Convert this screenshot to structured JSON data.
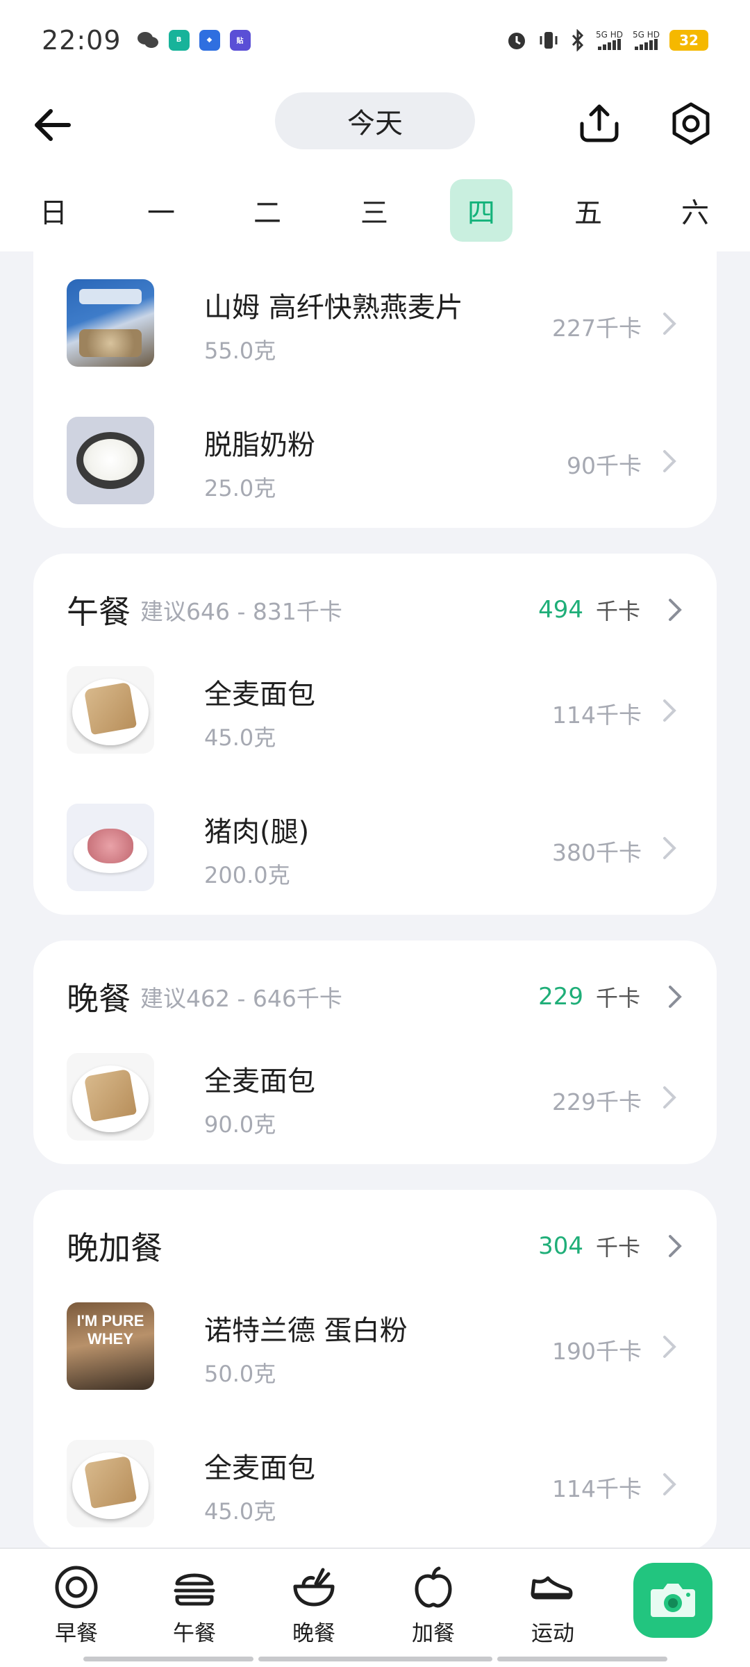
{
  "status_bar": {
    "time": "22:09",
    "battery": "32",
    "network_1": "5G HD",
    "network_2": "5G HD",
    "icons": [
      "wechat-icon",
      "boss-app-icon",
      "app-blue-icon",
      "tie-app-icon",
      "alarm-icon",
      "vibrate-icon",
      "bluetooth-icon"
    ]
  },
  "header": {
    "date_label": "今天"
  },
  "week": {
    "days": [
      "日",
      "一",
      "二",
      "三",
      "四",
      "五",
      "六"
    ],
    "selected_index": 4
  },
  "sections": {
    "breakfast_tail": {
      "items": [
        {
          "name": "山姆 高纤快熟燕麦片",
          "weight": "55.0克",
          "kcal": "227千卡"
        },
        {
          "name": "脱脂奶粉",
          "weight": "25.0克",
          "kcal": "90千卡"
        }
      ]
    },
    "lunch": {
      "title": "午餐",
      "hint": "建议646 - 831千卡",
      "total": "494",
      "unit": "千卡",
      "items": [
        {
          "name": "全麦面包",
          "weight": "45.0克",
          "kcal": "114千卡"
        },
        {
          "name": "猪肉(腿)",
          "weight": "200.0克",
          "kcal": "380千卡"
        }
      ]
    },
    "dinner": {
      "title": "晚餐",
      "hint": "建议462 - 646千卡",
      "total": "229",
      "unit": "千卡",
      "items": [
        {
          "name": "全麦面包",
          "weight": "90.0克",
          "kcal": "229千卡"
        }
      ]
    },
    "late_snack": {
      "title": "晚加餐",
      "total": "304",
      "unit": "千卡",
      "items": [
        {
          "name": "诺特兰德 蛋白粉",
          "weight": "50.0克",
          "kcal": "190千卡",
          "package_text": "I'M PURE WHEY"
        },
        {
          "name": "全麦面包",
          "weight": "45.0克",
          "kcal": "114千卡"
        }
      ]
    }
  },
  "bottom_nav": {
    "items": [
      {
        "label": "早餐",
        "icon": "plate-icon"
      },
      {
        "label": "午餐",
        "icon": "burger-icon"
      },
      {
        "label": "晚餐",
        "icon": "bowl-icon"
      },
      {
        "label": "加餐",
        "icon": "apple-icon"
      },
      {
        "label": "运动",
        "icon": "sneaker-icon"
      }
    ],
    "camera_icon": "camera-icon"
  },
  "colors": {
    "accent": "#22c57f",
    "accent_text": "#1fae78",
    "selected_day_bg": "#c9efdf",
    "muted_text": "#a6a9b2"
  }
}
